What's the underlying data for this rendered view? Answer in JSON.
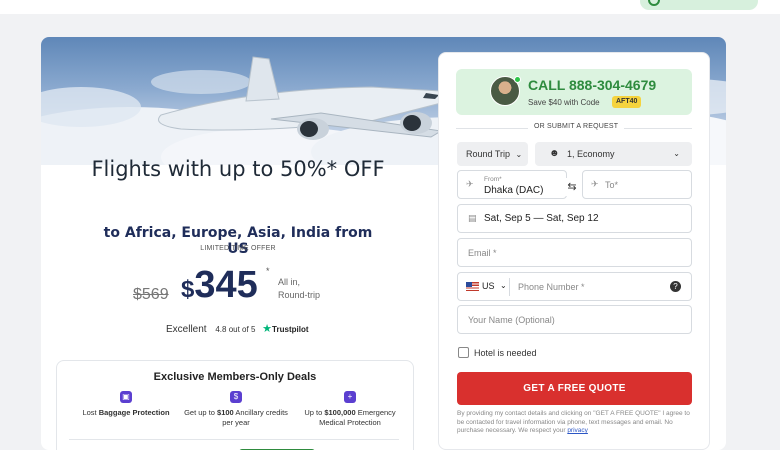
{
  "hero": {
    "headline": "Flights with up to 50%* OFF",
    "subhead": "to Africa, Europe, Asia, India from US",
    "limited": "LIMITED TIME OFFER"
  },
  "price": {
    "old": "$569",
    "currency": "$",
    "amount": "345",
    "asterisk": "*",
    "note_line1": "All in,",
    "note_line2": "Round-trip"
  },
  "rating": {
    "label": "Excellent",
    "score": "4.8 out of 5",
    "brand": "Trustpilot",
    "star_icon": "star-icon",
    "brand_color": "#00b67a"
  },
  "members": {
    "title": "Exclusive Members-Only Deals",
    "perks": [
      {
        "icon": "suitcase-icon",
        "pre": "Lost ",
        "bold": "Baggage Protection",
        "post": ""
      },
      {
        "icon": "dollar-icon",
        "pre": "Get up to ",
        "bold": "$100",
        "post": " Ancillary credits per year"
      },
      {
        "icon": "shield-plus-icon",
        "pre": "Up to ",
        "bold": "$100,000",
        "post": " Emergency Medical Protection"
      }
    ],
    "accent_color": "#5b3fd0"
  },
  "call": {
    "text": "CALL 888-304-4679",
    "save_text": "Save $40 with Code",
    "code": "AFT40",
    "color": "#2e8b3e"
  },
  "form": {
    "divider_text": "OR SUBMIT A REQUEST",
    "trip_type": "Round Trip",
    "travelers": "1, Economy",
    "from_label": "From*",
    "from_value": "Dhaka (DAC)",
    "to_placeholder": "To*",
    "dates": "Sat, Sep 5 — Sat, Sep 12",
    "email_placeholder": "Email *",
    "country": "US",
    "phone_placeholder": "Phone Number *",
    "name_placeholder": "Your Name (Optional)",
    "hotel_label": "Hotel is needed",
    "submit": "GET A FREE QUOTE",
    "submit_color": "#d9302e",
    "disclaimer": "By providing my contact details and clicking on \"GET A FREE QUOTE\" I agree to be contacted for travel information via phone, text messages and email. No purchase necessary. We respect your ",
    "privacy_link": "privacy"
  }
}
